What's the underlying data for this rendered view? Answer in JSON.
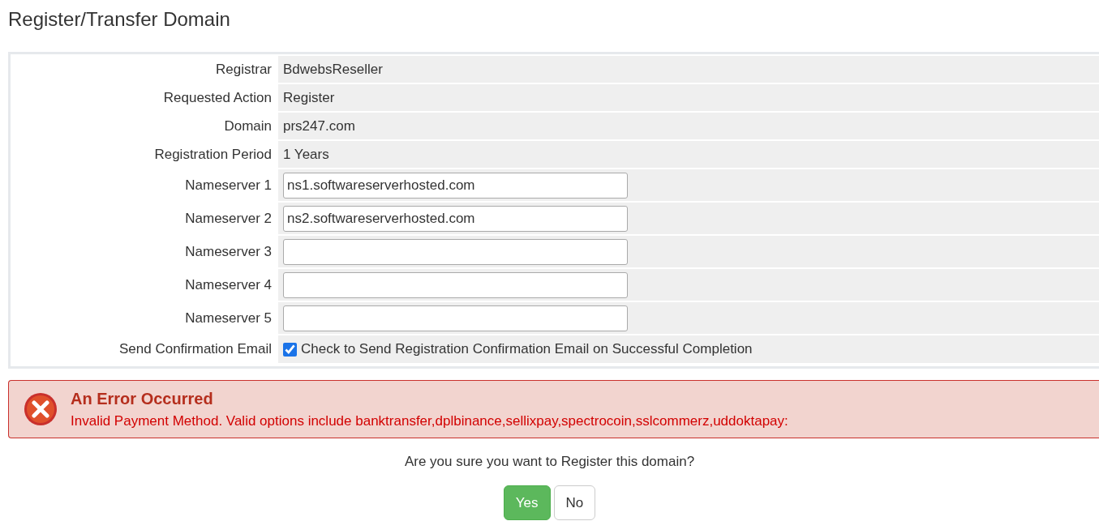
{
  "page_title": "Register/Transfer Domain",
  "fields": [
    {
      "kind": "text",
      "label": "Registrar",
      "value": "BdwebsReseller"
    },
    {
      "kind": "text",
      "label": "Requested Action",
      "value": "Register"
    },
    {
      "kind": "text",
      "label": "Domain",
      "value": "prs247.com"
    },
    {
      "kind": "text",
      "label": "Registration Period",
      "value": "1 Years"
    },
    {
      "kind": "input",
      "label": "Nameserver 1",
      "value": "ns1.softwareserverhosted.com"
    },
    {
      "kind": "input",
      "label": "Nameserver 2",
      "value": "ns2.softwareserverhosted.com"
    },
    {
      "kind": "input",
      "label": "Nameserver 3"
    },
    {
      "kind": "input",
      "label": "Nameserver 4"
    },
    {
      "kind": "input",
      "label": "Nameserver 5"
    },
    {
      "kind": "checkbox",
      "label": "Send Confirmation Email",
      "checked": true,
      "text": "Check to Send Registration Confirmation Email on Successful Completion"
    }
  ],
  "error": {
    "title": "An Error Occurred",
    "message": "Invalid Payment Method. Valid options include banktransfer,dplbinance,sellixpay,spectrocoin,sslcommerz,uddoktapay:"
  },
  "confirm": {
    "question": "Are you sure you want to Register this domain?",
    "buttons": [
      {
        "kind": "primary",
        "label": "Yes"
      },
      {
        "kind": "secondary",
        "label": "No"
      }
    ]
  }
}
